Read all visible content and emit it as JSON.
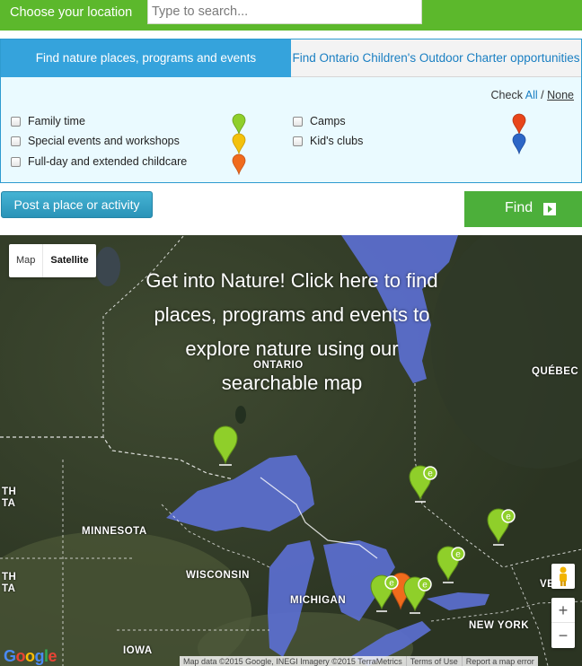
{
  "search": {
    "label": "Choose your location",
    "placeholder": "Type to search...",
    "value": ""
  },
  "tabs": [
    {
      "label": "Find nature places, programs and events",
      "active": true
    },
    {
      "label": "Find Ontario Children's Outdoor Charter opportunities",
      "active": false
    }
  ],
  "check": {
    "prefix": "Check",
    "all": "All",
    "separator": "/",
    "none": "None"
  },
  "filters": [
    {
      "label": "Family time",
      "marker_color": "#8fcf2a"
    },
    {
      "label": "Special events and workshops",
      "marker_color": "#f3c10c"
    },
    {
      "label": "Full-day and extended childcare",
      "marker_color": "#f06b1c"
    },
    {
      "label": "Camps",
      "marker_color": "#e8451a"
    },
    {
      "label": "Kid's clubs",
      "marker_color": "#2d66c6"
    }
  ],
  "actions": {
    "post": "Post a place or activity",
    "find": "Find"
  },
  "map": {
    "toggle": {
      "map": "Map",
      "satellite": "Satellite"
    },
    "overlay_text": "Get into Nature! Click here to find places, programs and events to explore nature using our searchable map",
    "labels": {
      "ontario": "ONTARIO",
      "quebec": "QUÉBEC",
      "minnesota": "MINNESOTA",
      "wisconsin": "WISCONSIN",
      "michigan": "MICHIGAN",
      "new_york": "NEW YORK",
      "iowa": "IOWA",
      "vermont_partial": "VE",
      "left_partial_1a": "TH",
      "left_partial_1b": "TA",
      "left_partial_2a": "TH",
      "left_partial_2b": "TA"
    },
    "pin_badge": "e",
    "zoom": {
      "in": "+",
      "out": "−"
    },
    "attribution": {
      "logo": "Google",
      "data": "Map data ©2015 Google, INEGI Imagery ©2015 TerraMetrics",
      "terms": "Terms of Use",
      "report": "Report a map error"
    }
  }
}
